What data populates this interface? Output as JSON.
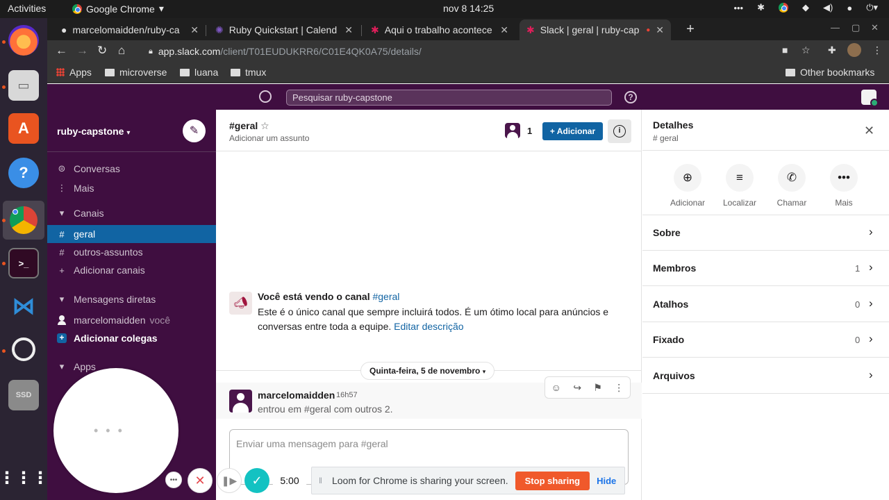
{
  "system": {
    "activities": "Activities",
    "app_menu": "Google Chrome",
    "clock": "nov 8  14:25"
  },
  "browser": {
    "tabs": [
      {
        "title": "marcelomaidden/ruby-ca",
        "active": false
      },
      {
        "title": "Ruby Quickstart | Calend",
        "active": false
      },
      {
        "title": "Aqui o trabalho acontece",
        "active": false
      },
      {
        "title": "Slack | geral | ruby-cap",
        "active": true
      }
    ],
    "url_host": "app.slack.com",
    "url_path": "/client/T01EUDUKRR6/C01E4QK0A75/details/",
    "bookmarks": [
      "Apps",
      "microverse",
      "luana",
      "tmux"
    ],
    "other_bookmarks": "Other bookmarks"
  },
  "slack": {
    "search_placeholder": "Pesquisar ruby-capstone",
    "workspace": "ruby-capstone",
    "sidebar": {
      "top": [
        {
          "label": "Conversas",
          "icon": "threads-icon"
        },
        {
          "label": "Mais",
          "icon": "more-vertical-icon"
        }
      ],
      "channels_header": "Canais",
      "channels": [
        {
          "label": "geral",
          "active": true
        },
        {
          "label": "outros-assuntos",
          "active": false
        }
      ],
      "add_channels": "Adicionar canais",
      "dm_header": "Mensagens diretas",
      "dm_user": "marcelomaidden",
      "dm_you": "você",
      "add_colleagues": "Adicionar colegas",
      "apps_header": "Apps"
    },
    "channel": {
      "name": "#geral",
      "topic": "Adicionar um assunto",
      "member_count": "1",
      "add_button": "Adicionar",
      "intro_title": "Você está vendo o canal",
      "intro_channel": "#geral",
      "intro_body": "Este é o único canal que sempre incluirá todos. É um ótimo local para anúncios e conversas entre toda a equipe.",
      "intro_edit": "Editar descrição",
      "day_divider": "Quinta-feira, 5 de novembro",
      "message": {
        "author": "marcelomaidden",
        "time": "16h57",
        "text": "entrou em #geral com outros 2."
      },
      "composer_placeholder": "Enviar uma mensagem para #geral"
    },
    "details": {
      "title": "Detalhes",
      "subtitle": "# geral",
      "actions": [
        "Adicionar",
        "Localizar",
        "Chamar",
        "Mais"
      ],
      "rows": [
        {
          "label": "Sobre",
          "count": ""
        },
        {
          "label": "Membros",
          "count": "1"
        },
        {
          "label": "Atalhos",
          "count": "0"
        },
        {
          "label": "Fixado",
          "count": "0"
        },
        {
          "label": "Arquivos",
          "count": ""
        }
      ]
    }
  },
  "loom": {
    "timer": "5:00",
    "sharing_message": "Loom for Chrome is sharing your screen.",
    "stop_label": "Stop sharing",
    "hide_label": "Hide"
  },
  "colors": {
    "slack_aubergine": "#3f0e40",
    "slack_blue": "#1164a3",
    "loom_orange": "#f0592b",
    "loom_teal": "#13c2c2"
  }
}
